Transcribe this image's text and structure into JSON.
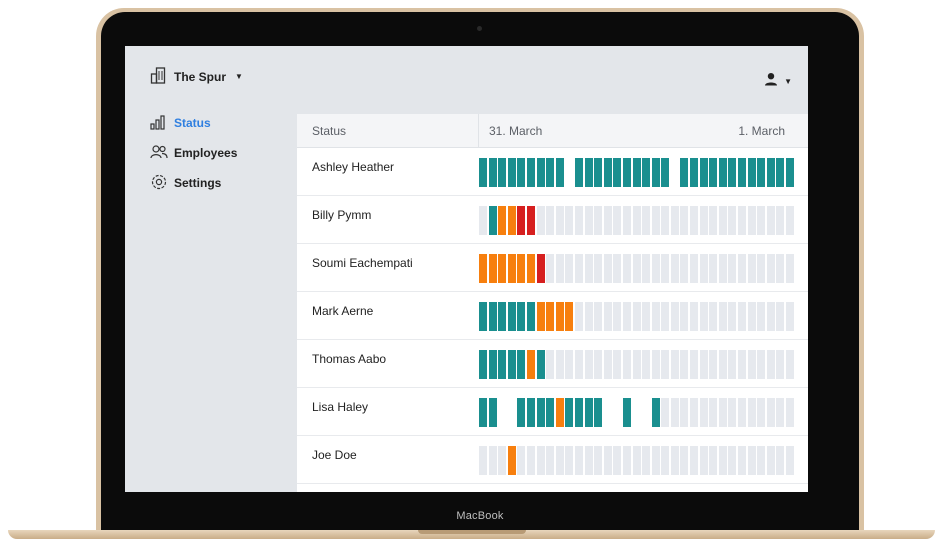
{
  "device": {
    "label": "MacBook"
  },
  "app": {
    "brand": "The Spur",
    "brand_icon": "building-icon",
    "user_icon": "user-icon"
  },
  "nav": {
    "items": [
      {
        "label": "Status",
        "icon": "chart-bars-icon",
        "active": true
      },
      {
        "label": "Employees",
        "icon": "users-icon",
        "active": false
      },
      {
        "label": "Settings",
        "icon": "gear-icon",
        "active": false
      }
    ]
  },
  "table": {
    "header": {
      "status": "Status",
      "date_start": "31. March",
      "date_end": "1. March"
    },
    "colors": {
      "T": "#1a8f8f",
      "O": "#f77f0e",
      "R": "#d61f1f",
      "E": "#e6e9ee",
      "W": "#ffffff"
    },
    "rows": [
      {
        "name": "Ashley Heather",
        "days": "TTTTTTTTTWTTTTTTTTTTWTTTTTTTTTTTT"
      },
      {
        "name": "Billy Pymm",
        "days": "ETOORREEEEEEEEEEEEEEEEEEEEEEEEEEE"
      },
      {
        "name": "Soumi Eachempati",
        "days": "OOOOOOREEEEEEEEEEEEEEEEEEEEEEEEEE"
      },
      {
        "name": "Mark Aerne",
        "days": "TTTTTTOOOOEEEEEEEEEEEEEEEEEEEEEEE"
      },
      {
        "name": "Thomas Aabo",
        "days": "TTTTTOTEEEEEEEEEEEEEEEEEEEEEEEEEE"
      },
      {
        "name": "Lisa Haley",
        "days": "TTWWTTTTOTTTTWWTWWTEEEEEEEEEEEEEE"
      },
      {
        "name": "Joe Doe",
        "days": "EEEOEEEEEEEEEEEEEEEEEEEEEEEEEEEEE"
      }
    ]
  }
}
